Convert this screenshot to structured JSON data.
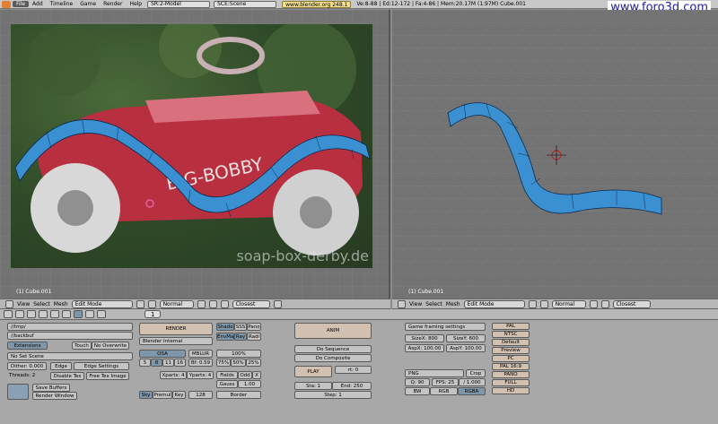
{
  "topbar": {
    "menus": [
      "File",
      "Add",
      "Timeline",
      "Game",
      "Render",
      "Help"
    ],
    "screen": "SR:2-Model",
    "scene": "SCE:Scene",
    "url": "www.blender.org 248.1",
    "stats": "Ve:8-88 | Ed:12-172 | Fa:4-86 | Mem:20.17M (1.97M) Cube.001",
    "watermark": "www.foro3d.com"
  },
  "left_view": {
    "photo_caption": "soap-box-derby.de",
    "object_label": "(1) Cube.001"
  },
  "right_view": {
    "object_label": "(1) Cube.001"
  },
  "view_header": {
    "menus": [
      "View",
      "Select",
      "Mesh"
    ],
    "mode": "Edit Mode",
    "pivot": "Normal",
    "snap": "Closest"
  },
  "buttons_header": {
    "frame": "1"
  },
  "output_panel": {
    "path1": "//tmp/",
    "path2": "//backbuf",
    "extensions": "Extensions",
    "touch": "Touch",
    "no_overwrite": "No Overwrite",
    "no_set_scene": "No Set Scene",
    "dither": "Dither: 0.000",
    "edge": "Edge",
    "edge_settings": "Edge Settings",
    "threads": "Threads: 2",
    "disable_tex": "Disable Tex",
    "free_tex_image": "Free Tex Image",
    "save_buffers": "Save Buffers",
    "render_window": "Render Window"
  },
  "render_panel": {
    "render": "RENDER",
    "engine": "Blender Internal",
    "shadow": "Shado",
    "sss": "SSS",
    "pano": "Pano",
    "envmap": "EnvMa",
    "ray": "Ray",
    "radio": "Radi",
    "osa": "OSA",
    "mblur": "MBLUR",
    "osa_values": [
      "5",
      "8",
      "11",
      "16"
    ],
    "bf": "Bf: 0.59",
    "percent": "100%",
    "percent_values": [
      "75%",
      "50%",
      "25%"
    ],
    "xparts": "Xparts: 4",
    "yparts": "Yparts: 4",
    "fields": "Fields",
    "odd": "Odd",
    "x": "X",
    "gauss": "Gauss",
    "gauss_value": "1.00",
    "sky": "Sky",
    "premul": "Premul",
    "key": "Key",
    "bits": "128",
    "border": "Border"
  },
  "anim_panel": {
    "anim": "ANIM",
    "do_sequence": "Do Sequence",
    "do_composite": "Do Composite",
    "play": "PLAY",
    "rt": "rt: 0",
    "sta": "Sta: 1",
    "end": "End: 250",
    "step": "Step: 1"
  },
  "format_panel": {
    "game_framing": "Game framing settings",
    "sizex": "SizeX: 800",
    "sizey": "SizeY: 600",
    "aspx": "AspX: 100.00",
    "aspy": "AspY: 100.00",
    "format": "PNG",
    "crop": "Crop",
    "quality": "Q: 90",
    "fps": "FPS: 25",
    "fps_base": "/ 1.000",
    "bw": "BW",
    "rgb": "RGB",
    "rgba": "RGBA",
    "presets": [
      "PAL",
      "NTSC",
      "Default",
      "Preview",
      "PC",
      "PAL 16:9",
      "PANO",
      "FULL",
      "HD"
    ]
  },
  "colors": {
    "mesh_blue": "#3a90d0",
    "car_red": "#c0384a",
    "ui_gray": "#a8a8a8"
  }
}
